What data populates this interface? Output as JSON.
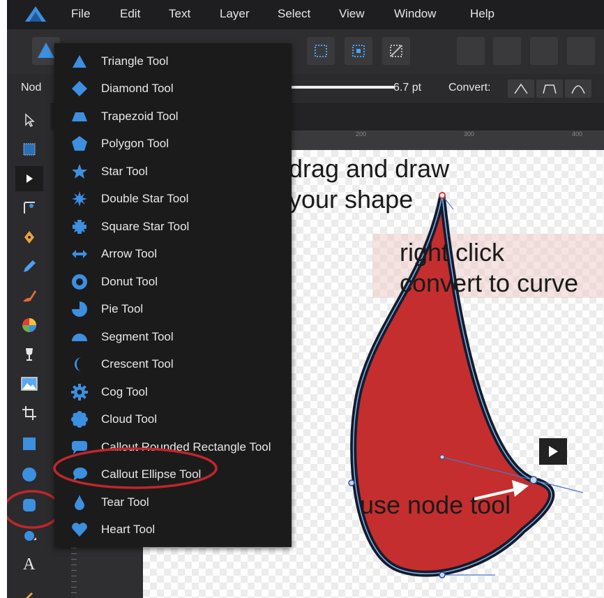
{
  "menubar": {
    "items": [
      "File",
      "Edit",
      "Text",
      "Layer",
      "Select",
      "View",
      "Window",
      "Help"
    ]
  },
  "context_bar": {
    "tool_label": "Nod",
    "stroke_width": "6.7 pt",
    "convert_label": "Convert:"
  },
  "ruler": {
    "ticks": [
      "200",
      "300",
      "400"
    ]
  },
  "shape_menu": {
    "items": [
      {
        "label": "Triangle Tool",
        "icon": "triangle-icon"
      },
      {
        "label": "Diamond Tool",
        "icon": "diamond-icon"
      },
      {
        "label": "Trapezoid Tool",
        "icon": "trapezoid-icon"
      },
      {
        "label": "Polygon Tool",
        "icon": "polygon-icon"
      },
      {
        "label": "Star Tool",
        "icon": "star-icon"
      },
      {
        "label": "Double Star Tool",
        "icon": "double-star-icon"
      },
      {
        "label": "Square Star Tool",
        "icon": "square-star-icon"
      },
      {
        "label": "Arrow Tool",
        "icon": "arrow-icon"
      },
      {
        "label": "Donut Tool",
        "icon": "donut-icon"
      },
      {
        "label": "Pie Tool",
        "icon": "pie-icon"
      },
      {
        "label": "Segment Tool",
        "icon": "segment-icon"
      },
      {
        "label": "Crescent Tool",
        "icon": "crescent-icon"
      },
      {
        "label": "Cog Tool",
        "icon": "cog-icon"
      },
      {
        "label": "Cloud Tool",
        "icon": "cloud-icon"
      },
      {
        "label": "Callout Rounded Rectangle Tool",
        "icon": "callout-rounded-rectangle-icon"
      },
      {
        "label": "Callout Ellipse Tool",
        "icon": "callout-ellipse-icon"
      },
      {
        "label": "Tear Tool",
        "icon": "tear-icon"
      },
      {
        "label": "Heart Tool",
        "icon": "heart-icon"
      }
    ]
  },
  "annotations": {
    "drag_line1": "drag and draw",
    "drag_line2": "your shape",
    "right_click_line1": "right click",
    "right_click_line2": "convert to curve",
    "use_node": "use node tool"
  },
  "colors": {
    "accent_blue": "#3d8fe0",
    "highlight_red": "#c0262b",
    "shape_fill": "#c42e2e"
  }
}
